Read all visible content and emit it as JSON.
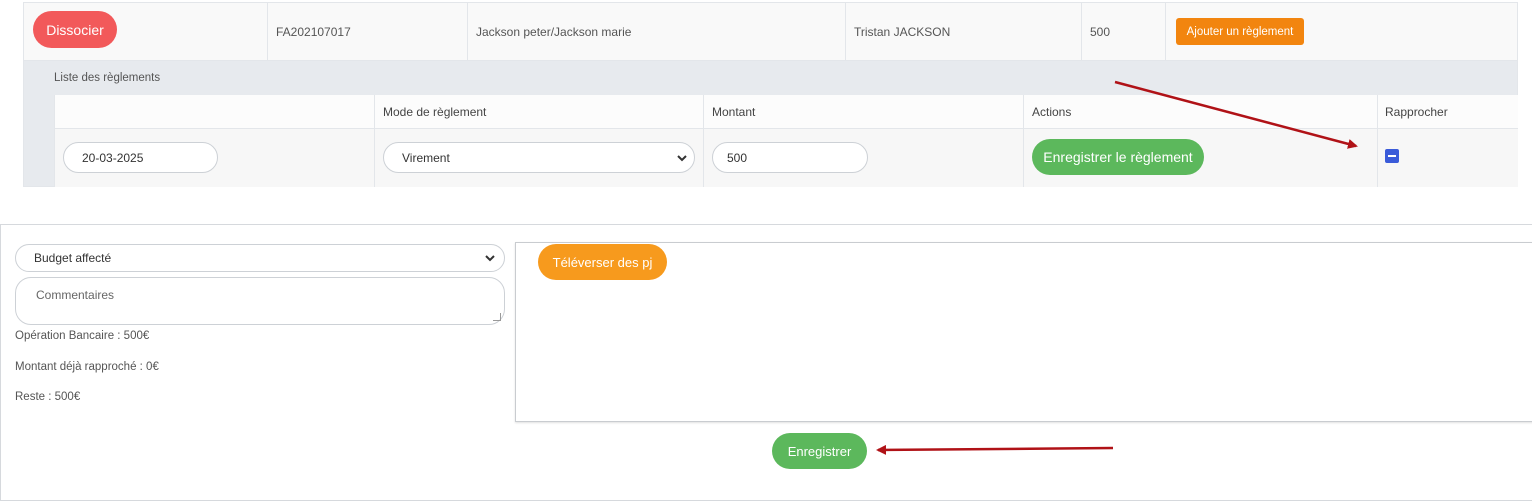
{
  "invoice": {
    "dissocier_label": "Dissocier",
    "number": "FA202107017",
    "clients": "Jackson peter/Jackson marie",
    "contact": "Tristan JACKSON",
    "amount": "500",
    "add_payment_label": "Ajouter un règlement"
  },
  "payments": {
    "title": "Liste des règlements",
    "headers": {
      "date": "",
      "mode": "Mode de règlement",
      "amount": "Montant",
      "actions": "Actions",
      "reconcile": "Rapprocher"
    },
    "row": {
      "date": "20-03-2025",
      "mode": "Virement",
      "amount": "500",
      "save_label": "Enregistrer le règlement"
    }
  },
  "form": {
    "budget_selected": "Budget affecté",
    "comment_placeholder": "Commentaires",
    "bank_operation": "Opération Bancaire : 500€",
    "already_reconciled": "Montant déjà rapproché : 0€",
    "remaining": "Reste : 500€",
    "upload_label": "Téléverser des pj",
    "save_label": "Enregistrer"
  },
  "colors": {
    "danger": "#f2595a",
    "warning": "#f2850f",
    "success": "#5cb85c",
    "upload": "#f79a1d",
    "checkbox": "#3a5bd9",
    "annotation_arrow": "#b01217"
  },
  "icons": {
    "select_chevron": "chevron-down-icon",
    "reconcile_toggle": "minus-square-icon",
    "annotation": "arrow-icon"
  }
}
